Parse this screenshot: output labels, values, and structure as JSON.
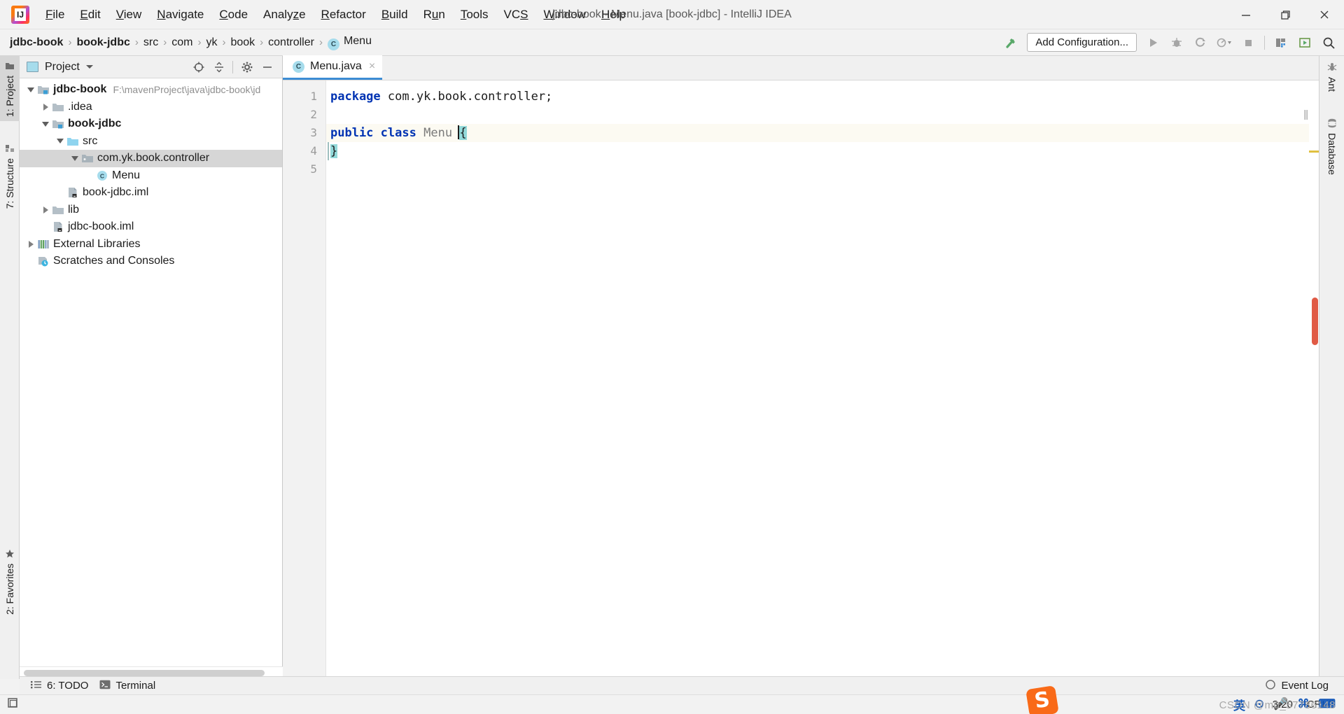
{
  "window": {
    "title": "jdbc-book - Menu.java [book-jdbc] - IntelliJ IDEA",
    "minimize_label": "minimize-icon",
    "maximize_label": "restore-icon",
    "close_label": "close-icon"
  },
  "menubar": {
    "items": [
      {
        "pre": "",
        "mn": "F",
        "post": "ile"
      },
      {
        "pre": "",
        "mn": "E",
        "post": "dit"
      },
      {
        "pre": "",
        "mn": "V",
        "post": "iew"
      },
      {
        "pre": "",
        "mn": "N",
        "post": "avigate"
      },
      {
        "pre": "",
        "mn": "C",
        "post": "ode"
      },
      {
        "pre": "Analy",
        "mn": "z",
        "post": "e"
      },
      {
        "pre": "",
        "mn": "R",
        "post": "efactor"
      },
      {
        "pre": "",
        "mn": "B",
        "post": "uild"
      },
      {
        "pre": "R",
        "mn": "u",
        "post": "n"
      },
      {
        "pre": "",
        "mn": "T",
        "post": "ools"
      },
      {
        "pre": "VC",
        "mn": "S",
        "post": ""
      },
      {
        "pre": "",
        "mn": "W",
        "post": "indow"
      },
      {
        "pre": "",
        "mn": "H",
        "post": "elp"
      }
    ]
  },
  "toolbar": {
    "breadcrumbs": [
      {
        "label": "jdbc-book",
        "bold": true,
        "badge": false
      },
      {
        "label": "book-jdbc",
        "bold": true,
        "badge": false
      },
      {
        "label": "src",
        "bold": false,
        "badge": false
      },
      {
        "label": "com",
        "bold": false,
        "badge": false
      },
      {
        "label": "yk",
        "bold": false,
        "badge": false
      },
      {
        "label": "book",
        "bold": false,
        "badge": false
      },
      {
        "label": "controller",
        "bold": false,
        "badge": false
      },
      {
        "label": "Menu",
        "bold": false,
        "badge": true
      }
    ],
    "badge_letter": "C",
    "add_configuration_label": "Add Configuration...",
    "icons": [
      "build-hammer-icon",
      "run-icon",
      "debug-icon",
      "run-with-coverage-icon",
      "profile-icon",
      "stop-icon",
      "sdk-manager-icon",
      "update-project-icon",
      "search-everywhere-icon"
    ]
  },
  "left_tool_strip": {
    "tabs": [
      {
        "label": "1: Project",
        "icon": "project-folder-icon",
        "active": true
      },
      {
        "label": "7: Structure",
        "icon": "structure-icon",
        "active": false
      },
      {
        "label": "2: Favorites",
        "icon": "star-icon",
        "active": false
      }
    ]
  },
  "right_tool_strip": {
    "tabs": [
      {
        "label": "Ant",
        "icon": "ant-icon"
      },
      {
        "label": "Database",
        "icon": "database-icon"
      }
    ]
  },
  "project_panel": {
    "title": "Project",
    "tools": [
      "locate-target-icon",
      "collapse-all-icon",
      "settings-gear-icon",
      "hide-panel-icon"
    ],
    "tree": [
      {
        "indent": 0,
        "arrow": "open",
        "icon": "module-folder-icon",
        "label": "jdbc-book",
        "bold": true,
        "path": "F:\\mavenProject\\java\\jdbc-book\\jd",
        "selected": false
      },
      {
        "indent": 1,
        "arrow": "closed",
        "icon": "folder-icon",
        "label": ".idea",
        "bold": false,
        "path": "",
        "selected": false
      },
      {
        "indent": 1,
        "arrow": "open",
        "icon": "module-folder-icon",
        "label": "book-jdbc",
        "bold": true,
        "path": "",
        "selected": false
      },
      {
        "indent": 2,
        "arrow": "open",
        "icon": "source-folder-icon",
        "label": "src",
        "bold": false,
        "path": "",
        "selected": false
      },
      {
        "indent": 3,
        "arrow": "open",
        "icon": "package-icon",
        "label": "com.yk.book.controller",
        "bold": false,
        "path": "",
        "selected": true
      },
      {
        "indent": 4,
        "arrow": "none",
        "icon": "java-class-icon",
        "label": "Menu",
        "bold": false,
        "path": "",
        "selected": false
      },
      {
        "indent": 2,
        "arrow": "none",
        "icon": "iml-file-icon",
        "label": "book-jdbc.iml",
        "bold": false,
        "path": "",
        "selected": false
      },
      {
        "indent": 1,
        "arrow": "closed",
        "icon": "folder-icon",
        "label": "lib",
        "bold": false,
        "path": "",
        "selected": false
      },
      {
        "indent": 1,
        "arrow": "none",
        "icon": "iml-file-icon",
        "label": "jdbc-book.iml",
        "bold": false,
        "path": "",
        "selected": false
      },
      {
        "indent": 0,
        "arrow": "closed",
        "icon": "external-libraries-icon",
        "label": "External Libraries",
        "bold": false,
        "path": "",
        "selected": false
      },
      {
        "indent": 0,
        "arrow": "none",
        "icon": "scratches-icon",
        "label": "Scratches and Consoles",
        "bold": false,
        "path": "",
        "selected": false
      }
    ]
  },
  "editor": {
    "tab": {
      "filename": "Menu.java",
      "badge_letter": "C",
      "close_label": "×"
    },
    "line_numbers": [
      "1",
      "2",
      "3",
      "4",
      "5"
    ],
    "lines": [
      {
        "n": 1,
        "highlight": false,
        "tokens": [
          {
            "t": "package",
            "c": "kw"
          },
          {
            "t": " com.yk.book.controller;",
            "c": ""
          }
        ]
      },
      {
        "n": 2,
        "highlight": false,
        "tokens": []
      },
      {
        "n": 3,
        "highlight": true,
        "tokens": [
          {
            "t": "public",
            "c": "kw"
          },
          {
            "t": " ",
            "c": ""
          },
          {
            "t": "class",
            "c": "kw"
          },
          {
            "t": " ",
            "c": ""
          },
          {
            "t": "Menu",
            "c": "type"
          },
          {
            "t": " ",
            "c": ""
          },
          {
            "t": "{",
            "c": "brace-hl"
          }
        ]
      },
      {
        "n": 4,
        "highlight": false,
        "tokens": [
          {
            "t": "}",
            "c": "brace-hl"
          }
        ]
      },
      {
        "n": 5,
        "highlight": false,
        "tokens": []
      }
    ]
  },
  "bottom_tool_bar": {
    "todo_label": "6: TODO",
    "todo_icon": "todo-list-icon",
    "terminal_label": "Terminal",
    "terminal_icon": "terminal-icon",
    "event_log_label": "Event Log",
    "event_log_icon": "event-log-icon"
  },
  "status_bar": {
    "memory_icon": "layout-icon",
    "caret_position": "3:20",
    "line_separator": "CRLF"
  },
  "overlays": {
    "ime_logo": "S",
    "ime_items": [
      "英",
      "⊙",
      "🎤",
      "⌘",
      "⌨"
    ],
    "watermark": "CSDN @m0_57786148"
  },
  "colors": {
    "accent_blue": "#3c8cd4",
    "keyword_blue": "#0033b3",
    "brace_highlight": "#93d9d9",
    "selection_gray": "#d6d6d6",
    "line_highlight": "#fcfaf2",
    "class_badge": "#a6dcec",
    "scrollbar_red": "#e05a45",
    "sogou_orange": "#f96a18"
  }
}
